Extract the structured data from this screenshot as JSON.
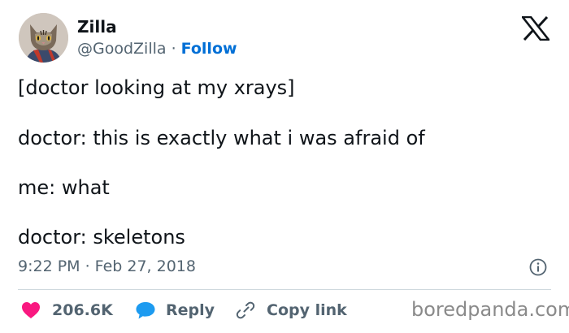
{
  "author": {
    "name": "Zilla",
    "handle": "@GoodZilla",
    "separator": " · ",
    "follow_label": "Follow"
  },
  "tweet": {
    "lines": [
      "[doctor looking at my xrays]",
      "doctor: this is exactly what i was afraid of",
      "me: what",
      "doctor: skeletons"
    ],
    "timestamp": "9:22 PM · Feb 27, 2018"
  },
  "actions": {
    "likes_count": "206.6K",
    "reply_label": "Reply",
    "copy_link_label": "Copy link"
  },
  "icons": {
    "avatar": "cat-avatar",
    "platform_logo": "x-logo-icon",
    "info": "info-icon",
    "like": "heart-icon",
    "reply": "speech-bubble-icon",
    "copy_link": "link-icon"
  },
  "colors": {
    "like": "#f91880",
    "reply": "#1d9bf0",
    "follow": "#006fd6",
    "secondary_text": "#536471"
  },
  "watermark": "boredpanda.com"
}
